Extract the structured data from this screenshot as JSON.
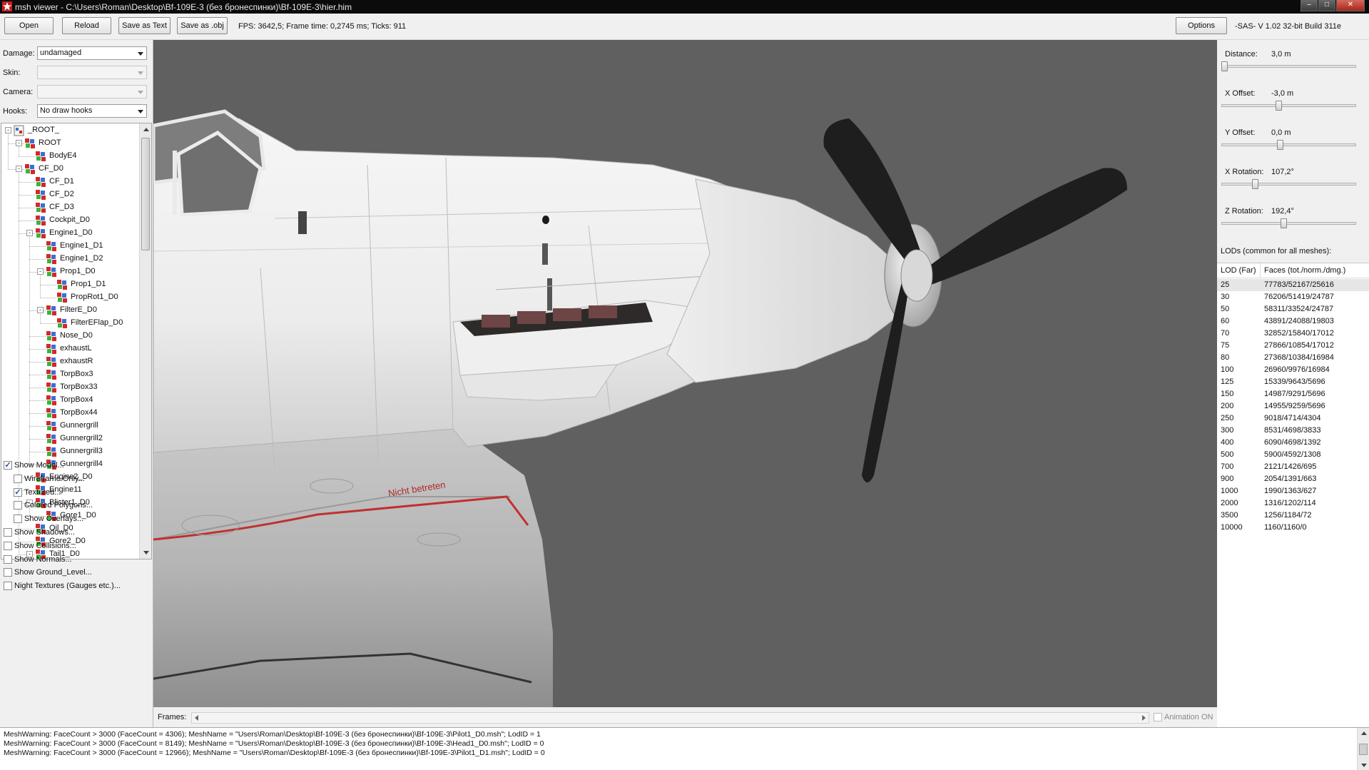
{
  "window": {
    "title": "msh viewer - C:\\Users\\Roman\\Desktop\\Bf-109E-3 (без бронеспинки)\\Bf-109E-3\\hier.him",
    "controls": {
      "minimize": "–",
      "maximize": "□",
      "close": "✕"
    }
  },
  "toolbar": {
    "open": "Open",
    "reload": "Reload",
    "save_text": "Save as Text",
    "save_obj": "Save as .obj",
    "fps": "FPS: 3642,5; Frame time: 0,2745 ms; Ticks: 911",
    "options": "Options",
    "version": "-SAS- V 1.02  32-bit  Build 311e"
  },
  "left": {
    "damage_label": "Damage:",
    "damage_value": "undamaged",
    "skin_label": "Skin:",
    "skin_value": "",
    "camera_label": "Camera:",
    "camera_value": "",
    "hooks_label": "Hooks:",
    "hooks_value": "No draw hooks"
  },
  "tree": [
    {
      "label": "_ROOT_",
      "level": 0,
      "exp": "-"
    },
    {
      "label": "ROOT",
      "level": 1,
      "exp": "-"
    },
    {
      "label": "BodyE4",
      "level": 2
    },
    {
      "label": "CF_D0",
      "level": 1,
      "exp": "-"
    },
    {
      "label": "CF_D1",
      "level": 2
    },
    {
      "label": "CF_D2",
      "level": 2
    },
    {
      "label": "CF_D3",
      "level": 2
    },
    {
      "label": "Cockpit_D0",
      "level": 2
    },
    {
      "label": "Engine1_D0",
      "level": 2,
      "exp": "-"
    },
    {
      "label": "Engine1_D1",
      "level": 3
    },
    {
      "label": "Engine1_D2",
      "level": 3
    },
    {
      "label": "Prop1_D0",
      "level": 3,
      "exp": "-"
    },
    {
      "label": "Prop1_D1",
      "level": 4
    },
    {
      "label": "PropRot1_D0",
      "level": 4
    },
    {
      "label": "FilterE_D0",
      "level": 3,
      "exp": "-"
    },
    {
      "label": "FilterEFlap_D0",
      "level": 4
    },
    {
      "label": "Nose_D0",
      "level": 3
    },
    {
      "label": "exhaustL",
      "level": 3
    },
    {
      "label": "exhaustR",
      "level": 3
    },
    {
      "label": "TorpBox3",
      "level": 3
    },
    {
      "label": "TorpBox33",
      "level": 3
    },
    {
      "label": "TorpBox4",
      "level": 3
    },
    {
      "label": "TorpBox44",
      "level": 3
    },
    {
      "label": "Gunnergrill",
      "level": 3
    },
    {
      "label": "Gunnergrill2",
      "level": 3
    },
    {
      "label": "Gunnergrill3",
      "level": 3
    },
    {
      "label": "Gunnergrill4",
      "level": 3
    },
    {
      "label": "Engine2_D0",
      "level": 2
    },
    {
      "label": "Engine11",
      "level": 2
    },
    {
      "label": "Blister1_D0",
      "level": 2,
      "exp": "-"
    },
    {
      "label": "Gore1_D0",
      "level": 3
    },
    {
      "label": "Oil_D0",
      "level": 2
    },
    {
      "label": "Gore2_D0",
      "level": 2
    },
    {
      "label": "Tail1_D0",
      "level": 2,
      "exp": "-"
    }
  ],
  "options": [
    {
      "label": "Show Model...",
      "checked": true,
      "indent": 0
    },
    {
      "label": "Wireframe Only...",
      "checked": false,
      "indent": 1
    },
    {
      "label": "Textured...",
      "checked": true,
      "indent": 1
    },
    {
      "label": "Colored Polygons...",
      "checked": false,
      "indent": 1
    },
    {
      "label": "Show Overlays...",
      "checked": false,
      "indent": 1
    },
    {
      "label": "Show Shadows...",
      "checked": false,
      "indent": 0
    },
    {
      "label": "Show Collisions...",
      "checked": false,
      "indent": 0
    },
    {
      "label": "Show Normals...",
      "checked": false,
      "indent": 0
    },
    {
      "label": "Show Ground_Level...",
      "checked": false,
      "indent": 0
    },
    {
      "label": "Night Textures (Gauges etc.)...",
      "checked": false,
      "indent": 0
    }
  ],
  "viewport": {
    "wing_text": "Nicht betreten",
    "background": "#606060"
  },
  "frames": {
    "label": "Frames:",
    "animation_label": "Animation ON",
    "animation_on": false
  },
  "right": {
    "sliders": [
      {
        "label": "Distance:",
        "value": "3,0 m",
        "fraction": 0.0
      },
      {
        "label": "X Offset:",
        "value": "-3,0 m",
        "fraction": 0.42
      },
      {
        "label": "Y Offset:",
        "value": "0,0 m",
        "fraction": 0.43
      },
      {
        "label": "X Rotation:",
        "value": "107,2°",
        "fraction": 0.24
      },
      {
        "label": "Z Rotation:",
        "value": "192,4°",
        "fraction": 0.46
      }
    ],
    "lods_title": "LODs (common for all meshes):",
    "lod_col1": "LOD (Far)",
    "lod_col2": "Faces (tot./norm./dmg.)",
    "lods": [
      {
        "lod": "25",
        "faces": "77783/52167/25616"
      },
      {
        "lod": "30",
        "faces": "76206/51419/24787"
      },
      {
        "lod": "50",
        "faces": "58311/33524/24787"
      },
      {
        "lod": "60",
        "faces": "43891/24088/19803"
      },
      {
        "lod": "70",
        "faces": "32852/15840/17012"
      },
      {
        "lod": "75",
        "faces": "27866/10854/17012"
      },
      {
        "lod": "80",
        "faces": "27368/10384/16984"
      },
      {
        "lod": "100",
        "faces": "26960/9976/16984"
      },
      {
        "lod": "125",
        "faces": "15339/9643/5696"
      },
      {
        "lod": "150",
        "faces": "14987/9291/5696"
      },
      {
        "lod": "200",
        "faces": "14955/9259/5696"
      },
      {
        "lod": "250",
        "faces": "9018/4714/4304"
      },
      {
        "lod": "300",
        "faces": "8531/4698/3833"
      },
      {
        "lod": "400",
        "faces": "6090/4698/1392"
      },
      {
        "lod": "500",
        "faces": "5900/4592/1308"
      },
      {
        "lod": "700",
        "faces": "2121/1426/695"
      },
      {
        "lod": "900",
        "faces": "2054/1391/663"
      },
      {
        "lod": "1000",
        "faces": "1990/1363/627"
      },
      {
        "lod": "2000",
        "faces": "1316/1202/114"
      },
      {
        "lod": "3500",
        "faces": "1256/1184/72"
      },
      {
        "lod": "10000",
        "faces": "1160/1160/0"
      }
    ]
  },
  "log": [
    "MeshWarning: FaceCount > 3000 (FaceCount = 4306); MeshName = \"Users\\Roman\\Desktop\\Bf-109E-3 (без бронеспинки)\\Bf-109E-3\\Pilot1_D0.msh\"; LodID = 1",
    "MeshWarning: FaceCount > 3000 (FaceCount = 8149); MeshName = \"Users\\Roman\\Desktop\\Bf-109E-3 (без бронеспинки)\\Bf-109E-3\\Head1_D0.msh\"; LodID = 0",
    "MeshWarning: FaceCount > 3000 (FaceCount = 12966); MeshName = \"Users\\Roman\\Desktop\\Bf-109E-3 (без бронеспинки)\\Bf-109E-3\\Pilot1_D1.msh\"; LodID = 0"
  ],
  "colors": {
    "accent": "#2a4f9c",
    "titlebar": "#0b0b0c",
    "propeller": "#1e1e1e"
  }
}
